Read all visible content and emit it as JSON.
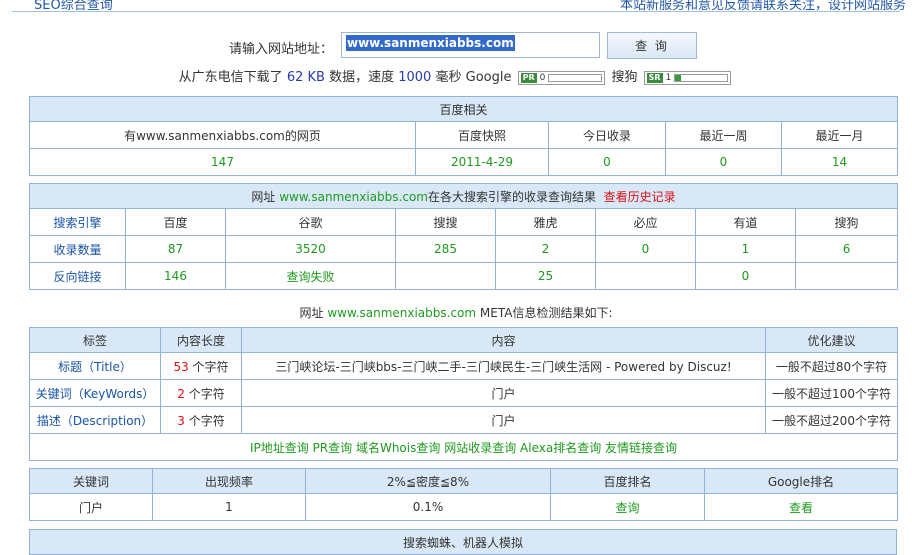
{
  "topbar": {
    "left": "SEO综合查询",
    "right": "本站新服务和意见反馈请联系关注，设计网站服务"
  },
  "search": {
    "label": "请输入网站地址：",
    "value": "www.sanmenxiabbs.com",
    "button": "查 询"
  },
  "stats": {
    "prefix": "从广东电信下载了",
    "size": "62 KB",
    "mid": "数据，速度",
    "speed": "1000",
    "suffix": "毫秒",
    "google_label": "Google",
    "pr_badge": "PR",
    "pr_value": "0",
    "pr_fill": 0,
    "sogou_label": "搜狗",
    "sr_badge": "SR",
    "sr_value": "1",
    "sr_fill": 0.1
  },
  "baidu": {
    "title": "百度相关",
    "headers": [
      "有www.sanmenxiabbs.com的网页",
      "百度快照",
      "今日收录",
      "最近一周",
      "最近一月"
    ],
    "values": [
      "147",
      "2011-4-29",
      "0",
      "0",
      "14"
    ]
  },
  "engines": {
    "title_prefix": "网址",
    "title_domain": "www.sanmenxiabbs.com",
    "title_suffix": "在各大搜索引擎的收录查询结果",
    "history_link": "查看历史记录",
    "headers": [
      "搜索引擎",
      "百度",
      "谷歌",
      "搜搜",
      "雅虎",
      "必应",
      "有道",
      "搜狗"
    ],
    "indexed_label": "收录数量",
    "indexed": [
      "87",
      "3520",
      "285",
      "2",
      "0",
      "1",
      "6"
    ],
    "backlinks_label": "反向链接",
    "backlinks": [
      "146",
      "查询失败",
      "",
      "25",
      "",
      "0",
      ""
    ]
  },
  "meta_caption": {
    "prefix": "网址",
    "domain": "www.sanmenxiabbs.com",
    "suffix": "META信息检测结果如下:"
  },
  "meta": {
    "headers": [
      "标签",
      "内容长度",
      "内容",
      "优化建议"
    ],
    "rows": [
      {
        "tag": "标题（Title）",
        "len": "53",
        "unit": "个字符",
        "content": "三门峡论坛-三门峡bbs-三门峡二手-三门峡民生-三门峡生活网 - Powered by Discuz!",
        "advice": "一般不超过80个字符"
      },
      {
        "tag": "关键词（KeyWords）",
        "len": "2",
        "unit": "个字符",
        "content": "门户",
        "advice": "一般不超过100个字符"
      },
      {
        "tag": "描述（Description）",
        "len": "3",
        "unit": "个字符",
        "content": "门户",
        "advice": "一般不超过200个字符"
      }
    ],
    "links": [
      "IP地址查询",
      "PR查询",
      "域名Whois查询",
      "网站收录查询",
      "Alexa排名查询",
      "友情链接查询"
    ]
  },
  "keywords": {
    "headers": [
      "关键词",
      "出现频率",
      "2%≦密度≦8%",
      "百度排名",
      "Google排名"
    ],
    "row": [
      "门户",
      "1",
      "0.1%",
      "查询",
      "查看"
    ]
  },
  "spider": {
    "title": "搜索蜘蛛、机器人模拟"
  }
}
